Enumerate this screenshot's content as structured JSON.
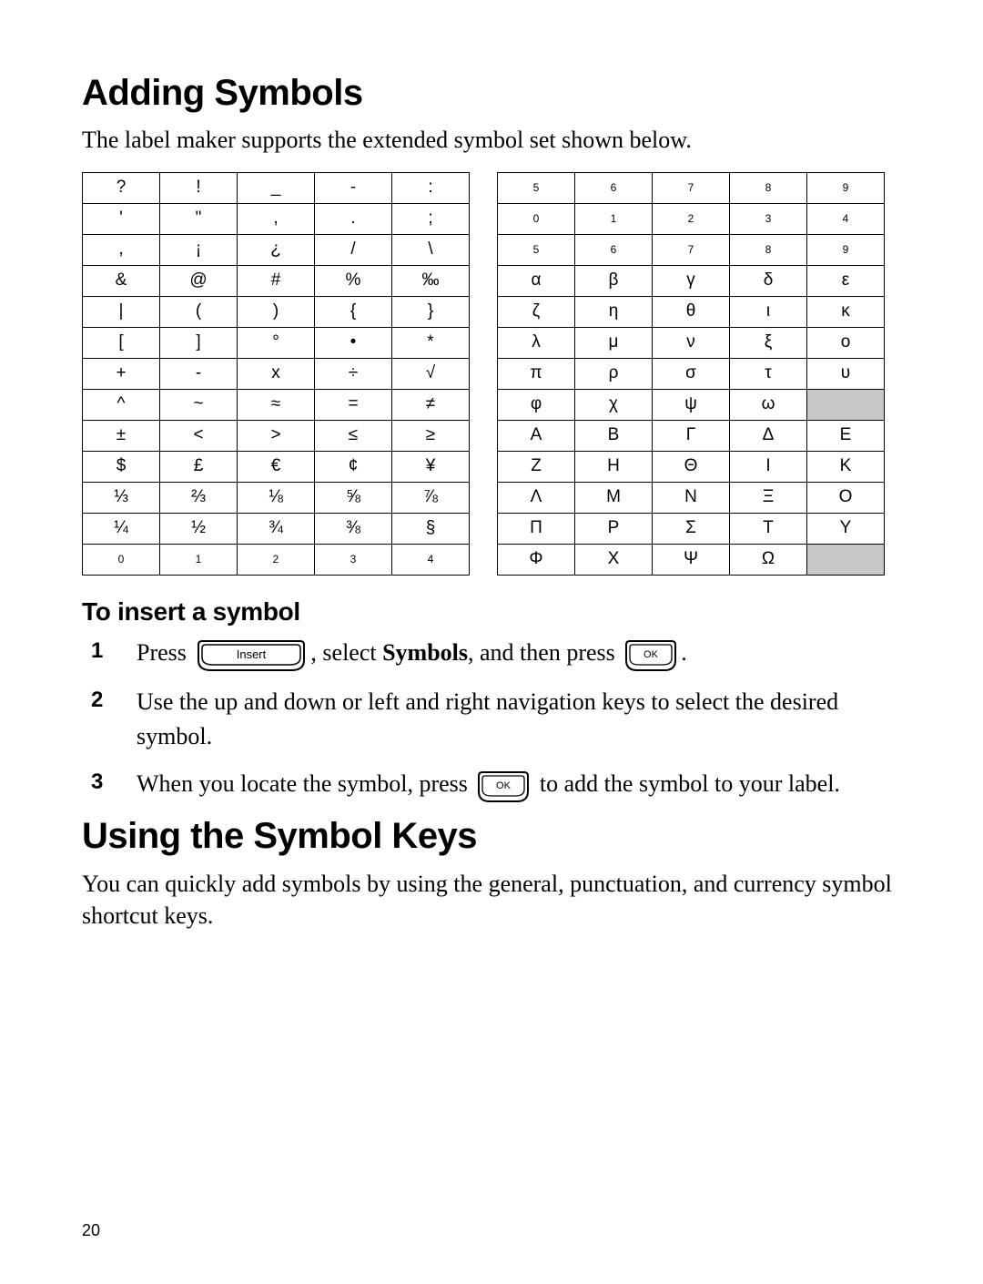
{
  "page_number": "20",
  "h1": "Adding Symbols",
  "intro": "The label maker supports the extended symbol set shown below.",
  "h1b": "Using the Symbol Keys",
  "body2": "You can quickly add symbols by using the general, punctuation, and currency symbol shortcut keys.",
  "subhead": "To insert a symbol",
  "key_labels": {
    "insert": "Insert",
    "ok": "OK"
  },
  "step1": {
    "a": "Press ",
    "b": ", select ",
    "bold": "Symbols",
    "c": ", and then press ",
    "d": "."
  },
  "step2": "Use the up and down or left and right navigation keys to select the desired symbol.",
  "step3": {
    "a": "When you locate the symbol, press ",
    "b": " to add the symbol to your label."
  },
  "symbol_table_left": [
    [
      "?",
      "!",
      "_",
      "-",
      ":"
    ],
    [
      "'",
      "\"",
      ",",
      ".",
      ";"
    ],
    [
      ",",
      "¡",
      "¿",
      "/",
      "\\"
    ],
    [
      "&",
      "@",
      "#",
      "%",
      "‰"
    ],
    [
      "|",
      "(",
      ")",
      "{",
      "}"
    ],
    [
      "[",
      "]",
      "°",
      "•",
      "*"
    ],
    [
      "+",
      "-",
      "x",
      "÷",
      "√"
    ],
    [
      "^",
      "~",
      "≈",
      "=",
      "≠"
    ],
    [
      "±",
      "<",
      ">",
      "≤",
      "≥"
    ],
    [
      "$",
      "£",
      "€",
      "¢",
      "¥"
    ],
    [
      "⅓",
      "⅔",
      "⅛",
      "⅝",
      "⅞"
    ],
    [
      "¼",
      "½",
      "¾",
      "⅜",
      "§"
    ],
    [
      "0",
      "1",
      "2",
      "3",
      "4"
    ]
  ],
  "left_small_rows": [
    12
  ],
  "symbol_table_right": [
    [
      "5",
      "6",
      "7",
      "8",
      "9"
    ],
    [
      "0",
      "1",
      "2",
      "3",
      "4"
    ],
    [
      "5",
      "6",
      "7",
      "8",
      "9"
    ],
    [
      "α",
      "β",
      "γ",
      "δ",
      "ε"
    ],
    [
      "ζ",
      "η",
      "θ",
      "ι",
      "κ"
    ],
    [
      "λ",
      "μ",
      "ν",
      "ξ",
      "ο"
    ],
    [
      "π",
      "ρ",
      "σ",
      "τ",
      "υ"
    ],
    [
      "φ",
      "χ",
      "ψ",
      "ω",
      ""
    ],
    [
      "Α",
      "Β",
      "Γ",
      "Δ",
      "Ε"
    ],
    [
      "Ζ",
      "Η",
      "Θ",
      "Ι",
      "Κ"
    ],
    [
      "Λ",
      "Μ",
      "Ν",
      "Ξ",
      "Ο"
    ],
    [
      "Π",
      "Ρ",
      "Σ",
      "Τ",
      "Υ"
    ],
    [
      "Φ",
      "Χ",
      "Ψ",
      "Ω",
      ""
    ]
  ],
  "right_small_rows": [
    0,
    1,
    2
  ],
  "right_shaded": [
    [
      7,
      4
    ],
    [
      12,
      4
    ]
  ],
  "chart_data": {
    "type": "table",
    "title": "Extended symbol set (two 13×5 tables)",
    "tables": [
      {
        "name": "left",
        "grid": [
          [
            "?",
            "!",
            "_",
            "-",
            ":"
          ],
          [
            "'",
            "\"",
            ",",
            ".",
            ";"
          ],
          [
            ",",
            "¡",
            "¿",
            "/",
            "\\"
          ],
          [
            "&",
            "@",
            "#",
            "%",
            "‰"
          ],
          [
            "|",
            "(",
            ")",
            "{",
            "}"
          ],
          [
            "[",
            "]",
            "°",
            "•",
            "*"
          ],
          [
            "+",
            "-",
            "x",
            "÷",
            "√"
          ],
          [
            "^",
            "~",
            "≈",
            "=",
            "≠"
          ],
          [
            "±",
            "<",
            ">",
            "≤",
            "≥"
          ],
          [
            "$",
            "£",
            "€",
            "¢",
            "¥"
          ],
          [
            "⅓",
            "⅔",
            "⅛",
            "⅝",
            "⅞"
          ],
          [
            "¼",
            "½",
            "¾",
            "⅜",
            "§"
          ],
          [
            "0",
            "1",
            "2",
            "3",
            "4"
          ]
        ]
      },
      {
        "name": "right",
        "grid": [
          [
            "5",
            "6",
            "7",
            "8",
            "9"
          ],
          [
            "0",
            "1",
            "2",
            "3",
            "4"
          ],
          [
            "5",
            "6",
            "7",
            "8",
            "9"
          ],
          [
            "α",
            "β",
            "γ",
            "δ",
            "ε"
          ],
          [
            "ζ",
            "η",
            "θ",
            "ι",
            "κ"
          ],
          [
            "λ",
            "μ",
            "ν",
            "ξ",
            "ο"
          ],
          [
            "π",
            "ρ",
            "σ",
            "τ",
            "υ"
          ],
          [
            "φ",
            "χ",
            "ψ",
            "ω",
            ""
          ],
          [
            "Α",
            "Β",
            "Γ",
            "Δ",
            "Ε"
          ],
          [
            "Ζ",
            "Η",
            "Θ",
            "Ι",
            "Κ"
          ],
          [
            "Λ",
            "Μ",
            "Ν",
            "Ξ",
            "Ο"
          ],
          [
            "Π",
            "Ρ",
            "Σ",
            "Τ",
            "Υ"
          ],
          [
            "Φ",
            "Χ",
            "Ψ",
            "Ω",
            ""
          ]
        ],
        "shaded_cells": [
          [
            7,
            4
          ],
          [
            12,
            4
          ]
        ]
      }
    ]
  }
}
